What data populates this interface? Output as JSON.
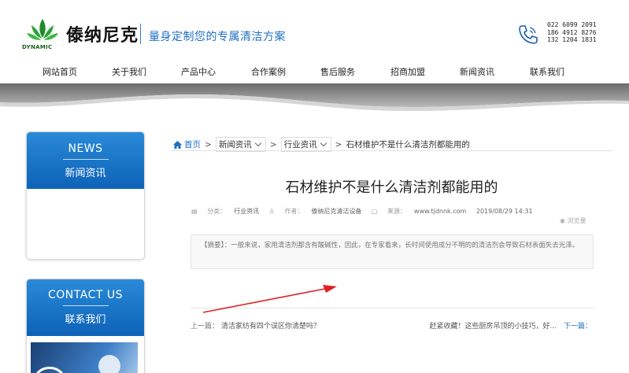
{
  "brand": {
    "name": "傣纳尼克",
    "logo_text": "DYNAMIC",
    "slogan": "量身定制您的专属清洁方案",
    "phones": [
      "022 6099 2091",
      "186 4912 8276",
      "132 1204 1831"
    ]
  },
  "nav": {
    "items": [
      "网站首页",
      "关于我们",
      "产品中心",
      "合作案例",
      "售后服务",
      "招商加盟",
      "新闻资讯",
      "联系我们"
    ]
  },
  "sidebar": {
    "news": {
      "en": "NEWS",
      "zh": "新闻资讯"
    },
    "contact": {
      "en": "CONTACT US",
      "zh": "联系我们"
    }
  },
  "breadcrumb": {
    "home": "首页",
    "level1": "新闻资讯",
    "level2": "行业资讯",
    "current": "石材维护不是什么清洁剂都能用的",
    "separator": ">"
  },
  "article": {
    "title": "石材维护不是什么清洁剂都能用的",
    "meta": {
      "category_label": "分类：",
      "category": "行业资讯",
      "author_label": "作者：",
      "author": "傣纳尼克清洁设备",
      "source_label": "来源：",
      "source": "www.tjdnnk.com",
      "date": "2019/08/29 14:31",
      "views_label": "浏览量"
    },
    "summary": "【摘要】：一般来说，家用清洁剂都含有酸碱性，因此，在专家看来，长时间使用成分不明的的清洁剂会导致石材表面失去光泽。"
  },
  "pager": {
    "prev_label": "上一篇：",
    "prev_title": "清洁家纺有四个误区你清楚吗？",
    "next_title": "赶紧收藏！这些厨房吊顶的小技巧，好...",
    "next_label": "下一篇："
  },
  "colors": {
    "accent": "#1d6fc2",
    "panel_top": "#2a8ad8",
    "panel_bottom": "#0d62b7",
    "annotation_arrow": "#e02020"
  }
}
